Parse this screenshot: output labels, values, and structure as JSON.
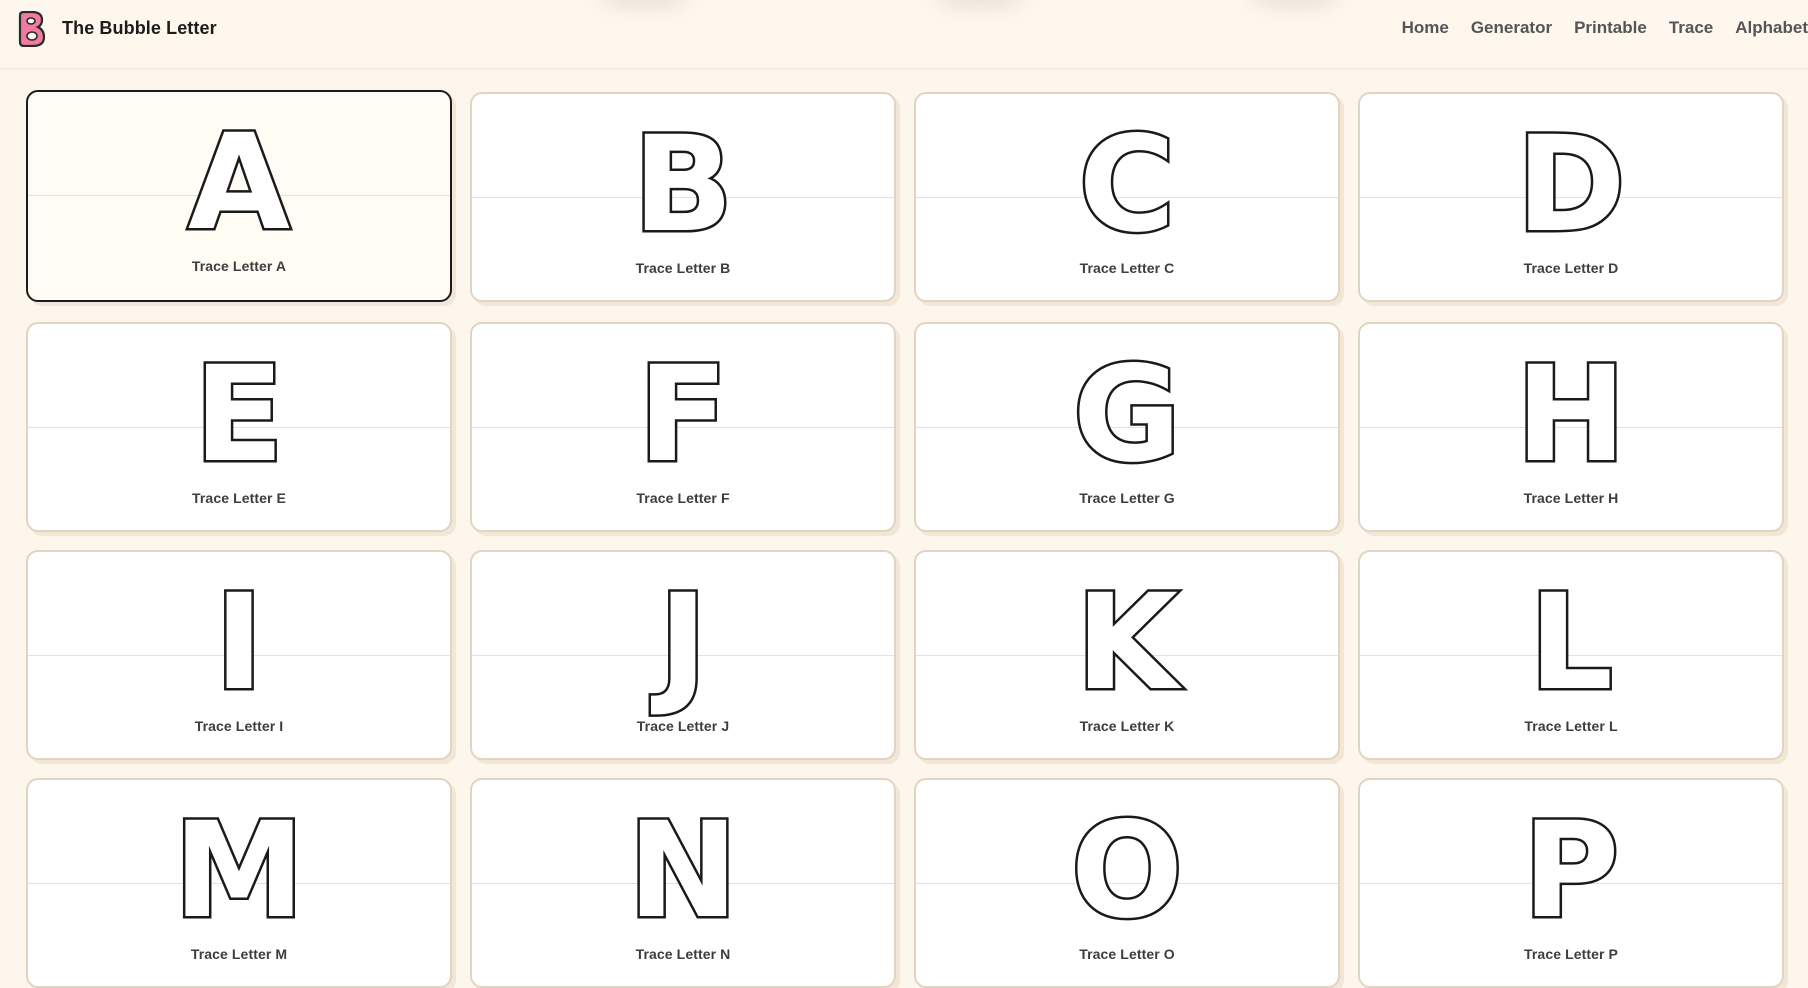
{
  "header": {
    "site_title": "The Bubble Letter",
    "logo_icon": "bubble-letter-b-icon",
    "nav": [
      "Home",
      "Generator",
      "Printable",
      "Trace",
      "Alphabet"
    ]
  },
  "cards": [
    {
      "letter": "A",
      "caption": "Trace Letter A",
      "active": true
    },
    {
      "letter": "B",
      "caption": "Trace Letter B"
    },
    {
      "letter": "C",
      "caption": "Trace Letter C"
    },
    {
      "letter": "D",
      "caption": "Trace Letter D"
    },
    {
      "letter": "E",
      "caption": "Trace Letter E"
    },
    {
      "letter": "F",
      "caption": "Trace Letter F"
    },
    {
      "letter": "G",
      "caption": "Trace Letter G"
    },
    {
      "letter": "H",
      "caption": "Trace Letter H"
    },
    {
      "letter": "I",
      "caption": "Trace Letter I"
    },
    {
      "letter": "J",
      "caption": "Trace Letter J"
    },
    {
      "letter": "K",
      "caption": "Trace Letter K"
    },
    {
      "letter": "L",
      "caption": "Trace Letter L"
    },
    {
      "letter": "M",
      "caption": "Trace Letter M"
    },
    {
      "letter": "N",
      "caption": "Trace Letter N"
    },
    {
      "letter": "O",
      "caption": "Trace Letter O"
    },
    {
      "letter": "P",
      "caption": "Trace Letter P"
    }
  ],
  "colors": {
    "background": "#fdf6ec",
    "card_border": "#e2d4c3",
    "active_border": "#1b1b1b",
    "logo_pink": "#f07aa0",
    "letter_outline": "#1a1a1a"
  }
}
